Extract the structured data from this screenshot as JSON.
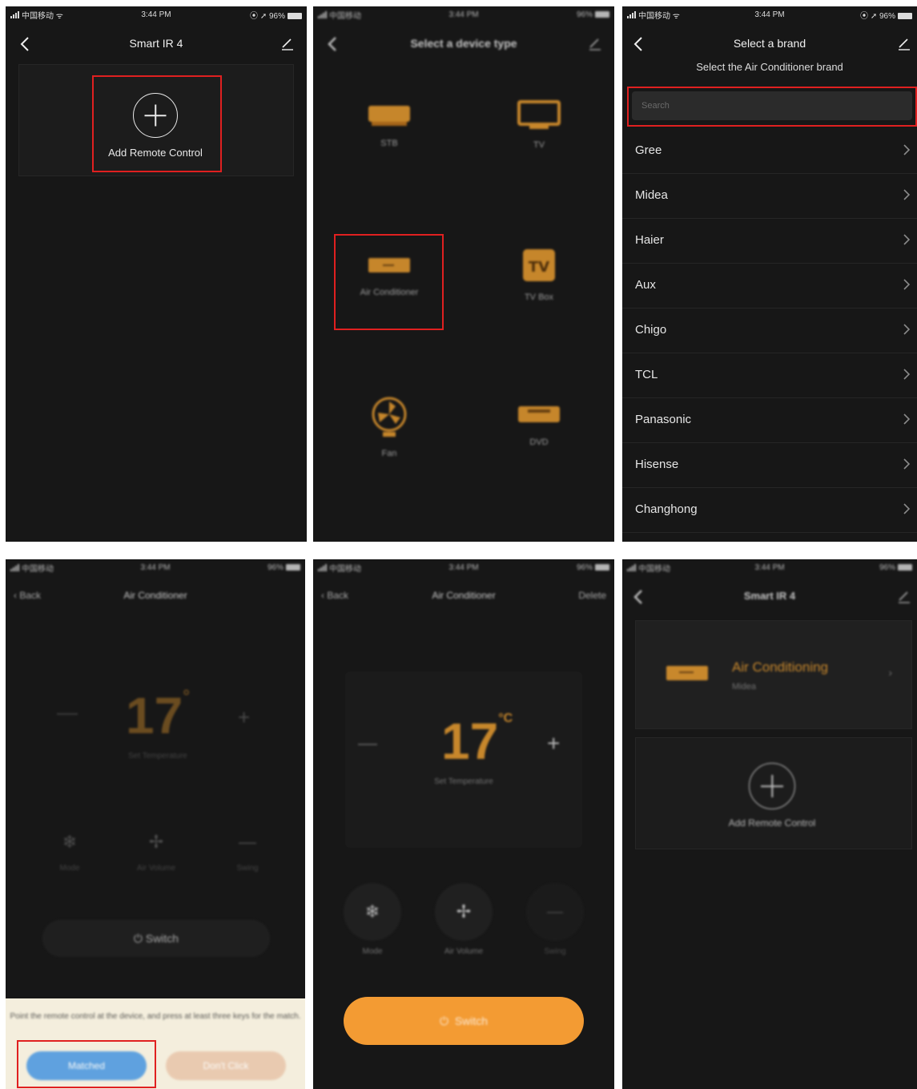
{
  "status": {
    "carrier": "中国移动",
    "time": "3:44 PM",
    "battery": "96%"
  },
  "screen1": {
    "title": "Smart IR 4",
    "add_label": "Add Remote Control"
  },
  "screen2": {
    "title": "Select a device type",
    "devices": [
      {
        "label": "STB",
        "icon": "stb-icon"
      },
      {
        "label": "TV",
        "icon": "tv-icon"
      },
      {
        "label": "Air Conditioner",
        "icon": "air-conditioner-icon"
      },
      {
        "label": "TV Box",
        "icon": "tv-box-icon",
        "badge": "TV"
      },
      {
        "label": "Fan",
        "icon": "fan-icon"
      },
      {
        "label": "DVD",
        "icon": "dvd-icon"
      }
    ]
  },
  "screen3": {
    "title": "Select a brand",
    "subtitle": "Select the Air Conditioner brand",
    "search_placeholder": "Search",
    "brands": [
      "Gree",
      "Midea",
      "Haier",
      "Aux",
      "Chigo",
      "TCL",
      "Panasonic",
      "Hisense",
      "Changhong"
    ]
  },
  "screen4": {
    "back_label": "Back",
    "title": "Air Conditioner",
    "temp": "17",
    "temp_unit": "°",
    "temp_label": "Set Temperature",
    "modes": [
      "Mode",
      "Air Volume",
      "Swing"
    ],
    "switch_label": "Switch",
    "prompt": "Point the remote control at the device, and press at least three keys for the match.",
    "match_label": "Matched",
    "skip_label": "Don't Click"
  },
  "screen5": {
    "back_label": "Back",
    "title": "Air Conditioner",
    "delete_label": "Delete",
    "temp": "17",
    "temp_unit": "°C",
    "temp_label": "Set Temperature",
    "modes": [
      "Mode",
      "Air Volume",
      "Swing"
    ],
    "switch_label": "Switch"
  },
  "screen6": {
    "title": "Smart IR 4",
    "device_name": "Air Conditioning",
    "device_brand": "Midea",
    "add_label": "Add Remote Control"
  },
  "colors": {
    "background": "#171717",
    "accent": "#f39b33",
    "highlight": "#e02020",
    "match_button": "#3a8fe0"
  }
}
